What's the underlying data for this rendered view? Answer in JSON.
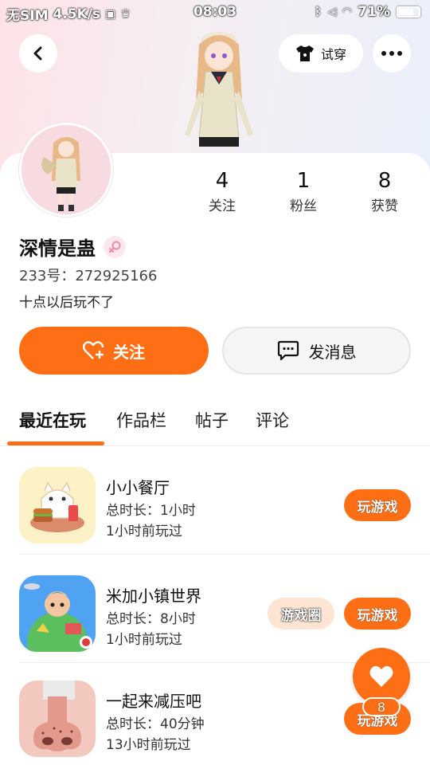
{
  "status_bar": {
    "carrier": "无SIM",
    "speed": "4.5K/s",
    "time": "08:03",
    "battery": "71%"
  },
  "header": {
    "tryon_label": "试穿"
  },
  "profile": {
    "stats": [
      {
        "value": "4",
        "label": "关注"
      },
      {
        "value": "1",
        "label": "粉丝"
      },
      {
        "value": "8",
        "label": "获赞"
      }
    ],
    "name": "深情是蛊",
    "uid": "233号：272925166",
    "bio": "十点以后玩不了"
  },
  "actions": {
    "follow_label": "关注",
    "message_label": "发消息"
  },
  "tabs": [
    {
      "label": "最近在玩"
    },
    {
      "label": "作品栏"
    },
    {
      "label": "帖子"
    },
    {
      "label": "评论"
    }
  ],
  "games": [
    {
      "name": "小小餐厅",
      "duration": "总时长：1小时",
      "last_played": "1小时前玩过",
      "play_label": "玩游戏"
    },
    {
      "name": "米加小镇世界",
      "duration": "总时长：8小时",
      "last_played": "1小时前玩过",
      "play_label": "玩游戏",
      "circle_label": "游戏圈"
    },
    {
      "name": "一起来减压吧",
      "duration": "总时长：40分钟",
      "last_played": "13小时前玩过",
      "play_label": "玩游戏"
    }
  ],
  "like_fab": {
    "count": "8"
  },
  "colors": {
    "accent": "#fe6e14",
    "gender_pink": "#f08aa8"
  }
}
